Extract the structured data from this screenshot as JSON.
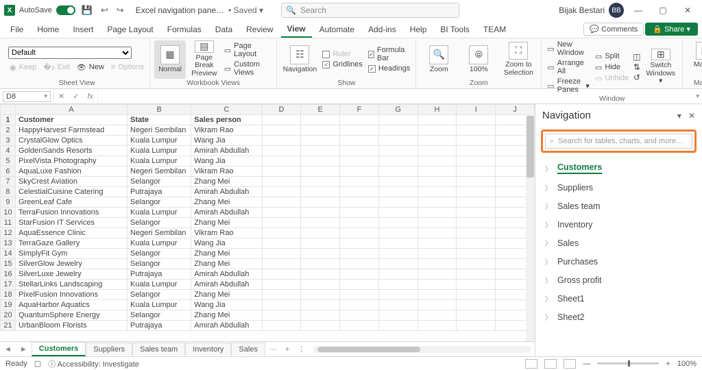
{
  "titlebar": {
    "autosave_label": "AutoSave",
    "autosave_state": "On",
    "doc_name": "Excel navigation pane…",
    "saved_text": "• Saved ▾",
    "search_placeholder": "Search",
    "user_name": "Bijak Bestari",
    "user_initials": "BB"
  },
  "tabs": {
    "items": [
      "File",
      "Home",
      "Insert",
      "Page Layout",
      "Formulas",
      "Data",
      "Review",
      "View",
      "Automate",
      "Add-ins",
      "Help",
      "BI Tools",
      "TEAM"
    ],
    "active": "View",
    "comments": "Comments",
    "share": "Share"
  },
  "ribbon": {
    "sheetview": {
      "default": "Default",
      "keep": "Keep",
      "exit": "Exit",
      "new": "New",
      "options": "Options",
      "label": "Sheet View"
    },
    "workbookviews": {
      "normal": "Normal",
      "pagebreak": "Page Break Preview",
      "pagelayout": "Page Layout",
      "custom": "Custom Views",
      "label": "Workbook Views"
    },
    "navigation": {
      "btn": "Navigation"
    },
    "show": {
      "ruler": "Ruler",
      "formulabar": "Formula Bar",
      "gridlines": "Gridlines",
      "headings": "Headings",
      "label": "Show"
    },
    "zoom": {
      "zoom": "Zoom",
      "hundred": "100%",
      "tosel": "Zoom to Selection",
      "label": "Zoom"
    },
    "window": {
      "newwin": "New Window",
      "arrange": "Arrange All",
      "freeze": "Freeze Panes",
      "split": "Split",
      "hide": "Hide",
      "unhide": "Unhide",
      "switch": "Switch Windows",
      "label": "Window"
    },
    "macros": {
      "btn": "Macros",
      "label": "Macros"
    }
  },
  "namebox": "D8",
  "columns": [
    "A",
    "B",
    "C",
    "D",
    "E",
    "F",
    "G",
    "H",
    "I",
    "J"
  ],
  "headers": {
    "A": "Customer",
    "B": "State",
    "C": "Sales person"
  },
  "rows": [
    {
      "n": 1,
      "A": "Customer",
      "B": "State",
      "C": "Sales person"
    },
    {
      "n": 2,
      "A": "HappyHarvest Farmstead",
      "B": "Negeri Sembilan",
      "C": "Vikram Rao"
    },
    {
      "n": 3,
      "A": "CrystalGlow Optics",
      "B": "Kuala Lumpur",
      "C": "Wang Jia"
    },
    {
      "n": 4,
      "A": "GoldenSands Resorts",
      "B": "Kuala Lumpur",
      "C": "Amirah Abdullah"
    },
    {
      "n": 5,
      "A": "PixelVista Photography",
      "B": "Kuala Lumpur",
      "C": "Wang Jia"
    },
    {
      "n": 6,
      "A": "AquaLuxe Fashion",
      "B": "Negeri Sembilan",
      "C": "Vikram Rao"
    },
    {
      "n": 7,
      "A": "SkyCrest Aviation",
      "B": "Selangor",
      "C": "Zhang Mei"
    },
    {
      "n": 8,
      "A": "CelestialCuisine Catering",
      "B": "Putrajaya",
      "C": "Amirah Abdullah"
    },
    {
      "n": 9,
      "A": "GreenLeaf Cafe",
      "B": "Selangor",
      "C": "Zhang Mei"
    },
    {
      "n": 10,
      "A": "TerraFusion Innovations",
      "B": "Kuala Lumpur",
      "C": "Amirah Abdullah"
    },
    {
      "n": 11,
      "A": "StarFusion IT Services",
      "B": "Selangor",
      "C": "Zhang Mei"
    },
    {
      "n": 12,
      "A": "AquaEssence Clinic",
      "B": "Negeri Sembilan",
      "C": "Vikram Rao"
    },
    {
      "n": 13,
      "A": "TerraGaze Gallery",
      "B": "Kuala Lumpur",
      "C": "Wang Jia"
    },
    {
      "n": 14,
      "A": "SimplyFit Gym",
      "B": "Selangor",
      "C": "Zhang Mei"
    },
    {
      "n": 15,
      "A": "SilverGlow Jewelry",
      "B": "Selangor",
      "C": "Zhang Mei"
    },
    {
      "n": 16,
      "A": "SilverLuxe Jewelry",
      "B": "Putrajaya",
      "C": "Amirah Abdullah"
    },
    {
      "n": 17,
      "A": "StellarLinks Landscaping",
      "B": "Kuala Lumpur",
      "C": "Amirah Abdullah"
    },
    {
      "n": 18,
      "A": "PixelFusion Innovations",
      "B": "Selangor",
      "C": "Zhang Mei"
    },
    {
      "n": 19,
      "A": "AquaHarbor Aquatics",
      "B": "Kuala Lumpur",
      "C": "Wang Jia"
    },
    {
      "n": 20,
      "A": "QuantumSphere Energy",
      "B": "Selangor",
      "C": "Zhang Mei"
    },
    {
      "n": 21,
      "A": "UrbanBloom Florists",
      "B": "Putrajaya",
      "C": "Amirah Abdullah"
    }
  ],
  "navpane": {
    "title": "Navigation",
    "search_placeholder": "Search for tables, charts, and more…",
    "items": [
      "Customers",
      "Suppliers",
      "Sales team",
      "Inventory",
      "Sales",
      "Purchases",
      "Gross profit",
      "Sheet1",
      "Sheet2"
    ],
    "active": "Customers"
  },
  "sheettabs": {
    "tabs": [
      "Customers",
      "Suppliers",
      "Sales team",
      "Inventory",
      "Sales"
    ],
    "active": "Customers"
  },
  "status": {
    "ready": "Ready",
    "accessibility": "Accessibility: Investigate",
    "zoom": "100%"
  }
}
